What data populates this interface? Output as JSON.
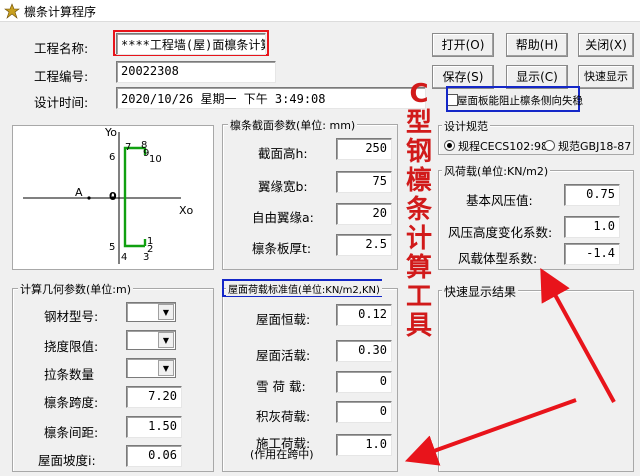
{
  "window": {
    "title": "檩条计算程序"
  },
  "project": {
    "name_label": "工程名称:",
    "name_value": "****工程墙(屋)面檩条计算",
    "code_label": "工程编号:",
    "code_value": "20022308",
    "time_label": "设计时间:",
    "time_value": "2020/10/26 星期一 下午 3:49:08"
  },
  "buttons": {
    "open": "打开(O)",
    "help": "帮助(H)",
    "close": "关闭(X)",
    "save": "保存(S)",
    "show": "显示(C)",
    "quick_show": "快速显示"
  },
  "checkbox": {
    "label": "屋面板能阻止檩条侧向失稳"
  },
  "section": {
    "axis_y": "Yo",
    "axis_x": "Xo",
    "point_a": "A",
    "point_0": "0",
    "points": {
      "p1": "1",
      "p2": "2",
      "p3": "3",
      "p4": "4",
      "p5": "5",
      "p6": "6",
      "p7": "7",
      "p8": "8",
      "p9": "9",
      "p10": "10"
    }
  },
  "cross_section": {
    "title": "檩条截面参数(单位: mm)",
    "height_label": "截面高h:",
    "height_value": "250",
    "flange_label": "翼缘宽b:",
    "flange_value": "75",
    "lip_label": "自由翼缘a:",
    "lip_value": "20",
    "thick_label": "檩条板厚t:",
    "thick_value": "2.5"
  },
  "code": {
    "title": "设计规范",
    "opt1": "规程CECS102:98",
    "opt2": "规范GBJ18-87"
  },
  "wind": {
    "title": "风荷载(单位:KN/m2)",
    "basic_label": "基本风压值:",
    "basic_value": "0.75",
    "height_label": "风压高度变化系数:",
    "height_value": "1.0",
    "shape_label": "风载体型系数:",
    "shape_value": "-1.4"
  },
  "geometry": {
    "title": "计算几何参数(单位:m)",
    "steel_label": "钢材型号:",
    "deflect_label": "挠度限值:",
    "tie_label": "拉条数量",
    "span_label": "檩条跨度:",
    "span_value": "7.20",
    "spacing_label": "檩条间距:",
    "spacing_value": "1.50",
    "slope_label": "屋面坡度i:",
    "slope_value": "0.06"
  },
  "loads": {
    "title": "屋面荷载标准值(单位:KN/m2,KN)",
    "dead_label": "屋面恒载:",
    "dead_value": "0.12",
    "live_label": "屋面活载:",
    "live_value": "0.30",
    "snow_label": "雪 荷 载:",
    "snow_value": "0",
    "ash_label": "积灰荷载:",
    "ash_value": "0",
    "const_label1": "施工荷载:",
    "const_label2": "(作用在跨中)",
    "const_value": "1.0"
  },
  "quick_result": {
    "title": "快速显示结果"
  },
  "annotation": {
    "chars": [
      "C",
      "型",
      "钢",
      "檩",
      "条",
      "计",
      "算",
      "工",
      "具"
    ]
  },
  "colors": {
    "red": "#e8141b",
    "blue": "#1427c8",
    "annotation": "#d11a1a"
  }
}
